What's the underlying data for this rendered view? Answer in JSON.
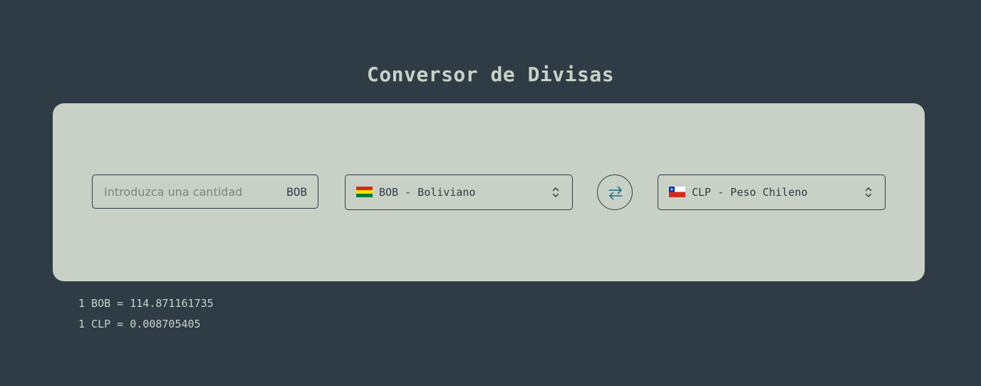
{
  "app": {
    "title": "Conversor de Divisas"
  },
  "amount": {
    "placeholder": "Introduzca una cantidad",
    "value": "",
    "currency_code": "BOB"
  },
  "from_currency": {
    "label": "BOB - Boliviano",
    "flag_icon": "bolivia-flag-icon",
    "flag_colors": [
      "#d52b1e",
      "#f9e300",
      "#007934"
    ]
  },
  "swap_button": {
    "icon": "swap-arrows-icon",
    "color": "#1f6f8b"
  },
  "to_currency": {
    "label": "CLP - Peso Chileno",
    "flag_icon": "chile-flag-icon",
    "flag_colors": [
      "#0039a6",
      "#ffffff",
      "#d52b1e"
    ]
  },
  "rates": {
    "line1": "1 BOB = 114.871161735",
    "line2": "1 CLP = 0.008705405"
  },
  "colors": {
    "background": "#2f3c46",
    "card": "#c9d1c6",
    "text_dark": "#2f3c46",
    "accent": "#1f6f8b"
  }
}
